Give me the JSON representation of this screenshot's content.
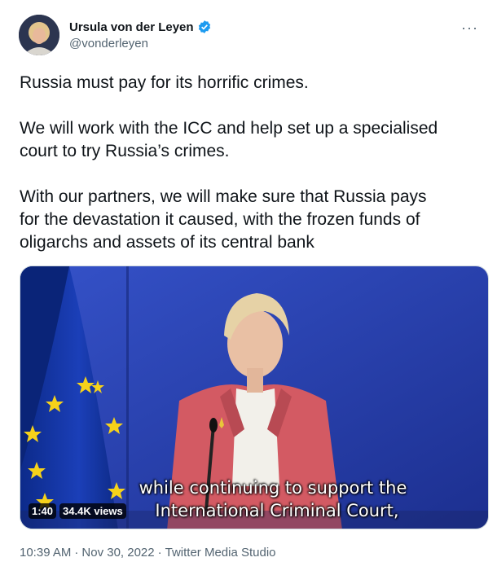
{
  "author": {
    "name": "Ursula von der Leyen",
    "handle": "@vonderleyen",
    "verified": true
  },
  "tweet": {
    "paragraphs": [
      "Russia must pay for its horrific crimes.",
      "We will work with the ICC and help set up a specialised\ncourt to try Russia’s crimes.",
      "With our partners, we will make sure that Russia pays\nfor the devastation it caused, with the frozen funds of\noligarchs and assets of its central bank"
    ]
  },
  "media": {
    "duration": "1:40",
    "views": "34.4K views",
    "subtitle_line1": "while continuing to support the",
    "subtitle_line2": "International Criminal Court,"
  },
  "footer": {
    "time": "10:39 AM",
    "date": "Nov 30, 2022",
    "source": "Twitter Media Studio"
  },
  "icons": {
    "more": "more-icon",
    "verified": "verified-badge-icon"
  },
  "colors": {
    "text": "#0f1419",
    "muted": "#536471",
    "verified": "#1d9bf0",
    "video_bg": "#2a45b8"
  }
}
